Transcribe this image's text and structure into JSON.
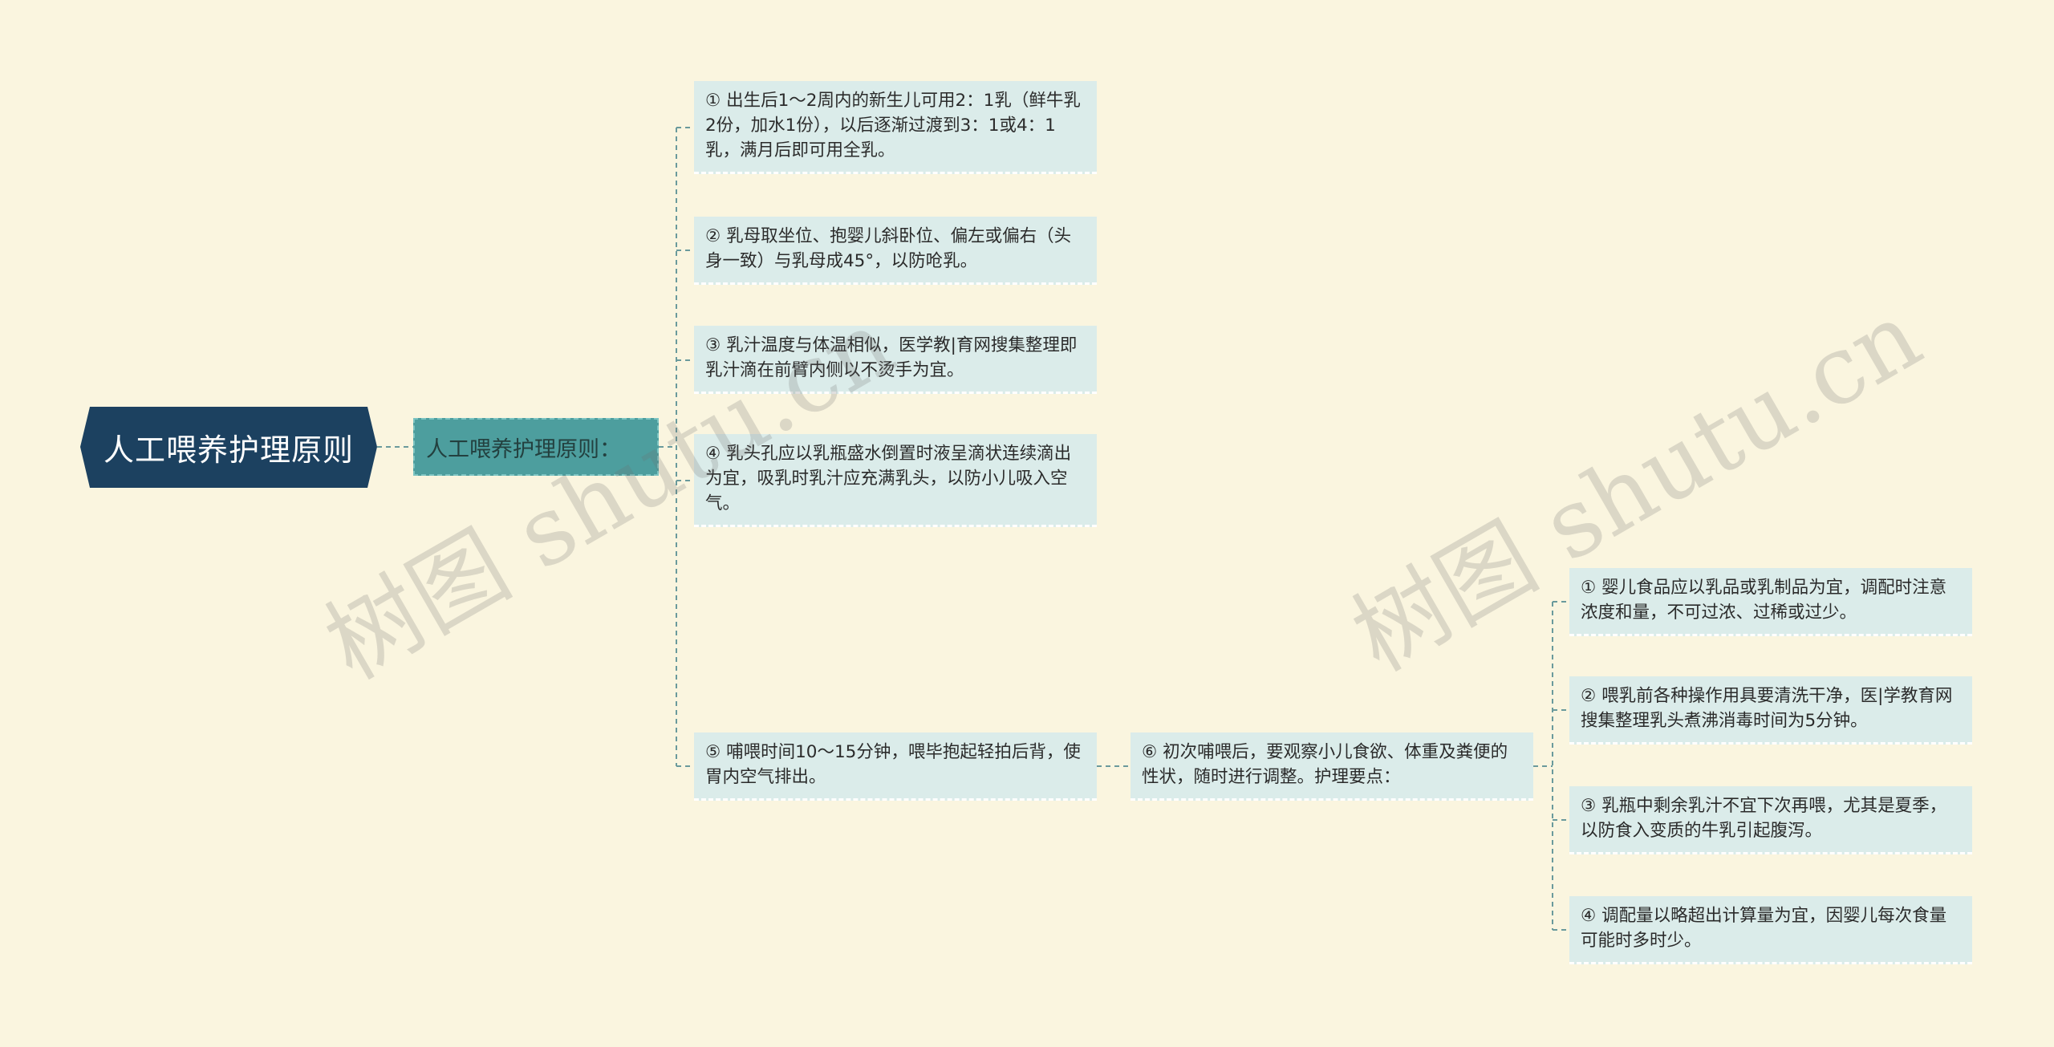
{
  "root": {
    "label": "人工喂养护理原则"
  },
  "principle": {
    "label": "人工喂养护理原则："
  },
  "leaves": [
    "① 出生后1～2周内的新生儿可用2：1乳（鲜牛乳2份，加水1份），以后逐渐过渡到3：1或4：1乳，满月后即可用全乳。",
    "② 乳母取坐位、抱婴儿斜卧位、偏左或偏右（头身一致）与乳母成45°，以防呛乳。",
    "③ 乳汁温度与体温相似，医学教|育网搜集整理即乳汁滴在前臂内侧以不烫手为宜。",
    "④ 乳头孔应以乳瓶盛水倒置时液呈滴状连续滴出为宜，吸乳时乳汁应充满乳头，以防小儿吸入空气。",
    "⑤ 哺喂时间10～15分钟，喂毕抱起轻拍后背，使胃内空气排出。",
    "⑥ 初次哺喂后，要观察小儿食欲、体重及粪便的性状，随时进行调整。护理要点："
  ],
  "care_points": [
    "① 婴儿食品应以乳品或乳制品为宜，调配时注意浓度和量，不可过浓、过稀或过少。",
    "② 喂乳前各种操作用具要清洗干净，医|学教育网搜集整理乳头煮沸消毒时间为5分钟。",
    "③ 乳瓶中剩余乳汁不宜下次再喂，尤其是夏季，以防食入变质的牛乳引起腹泻。",
    "④ 调配量以略超出计算量为宜，因婴儿每次食量可能时多时少。"
  ],
  "watermark": "树图 shutu.cn",
  "colors": {
    "background": "#faf5df",
    "root": "#1c4160",
    "principle": "#4d9e9e",
    "leaf": "#dbecea",
    "line": "#6a9a9c"
  }
}
